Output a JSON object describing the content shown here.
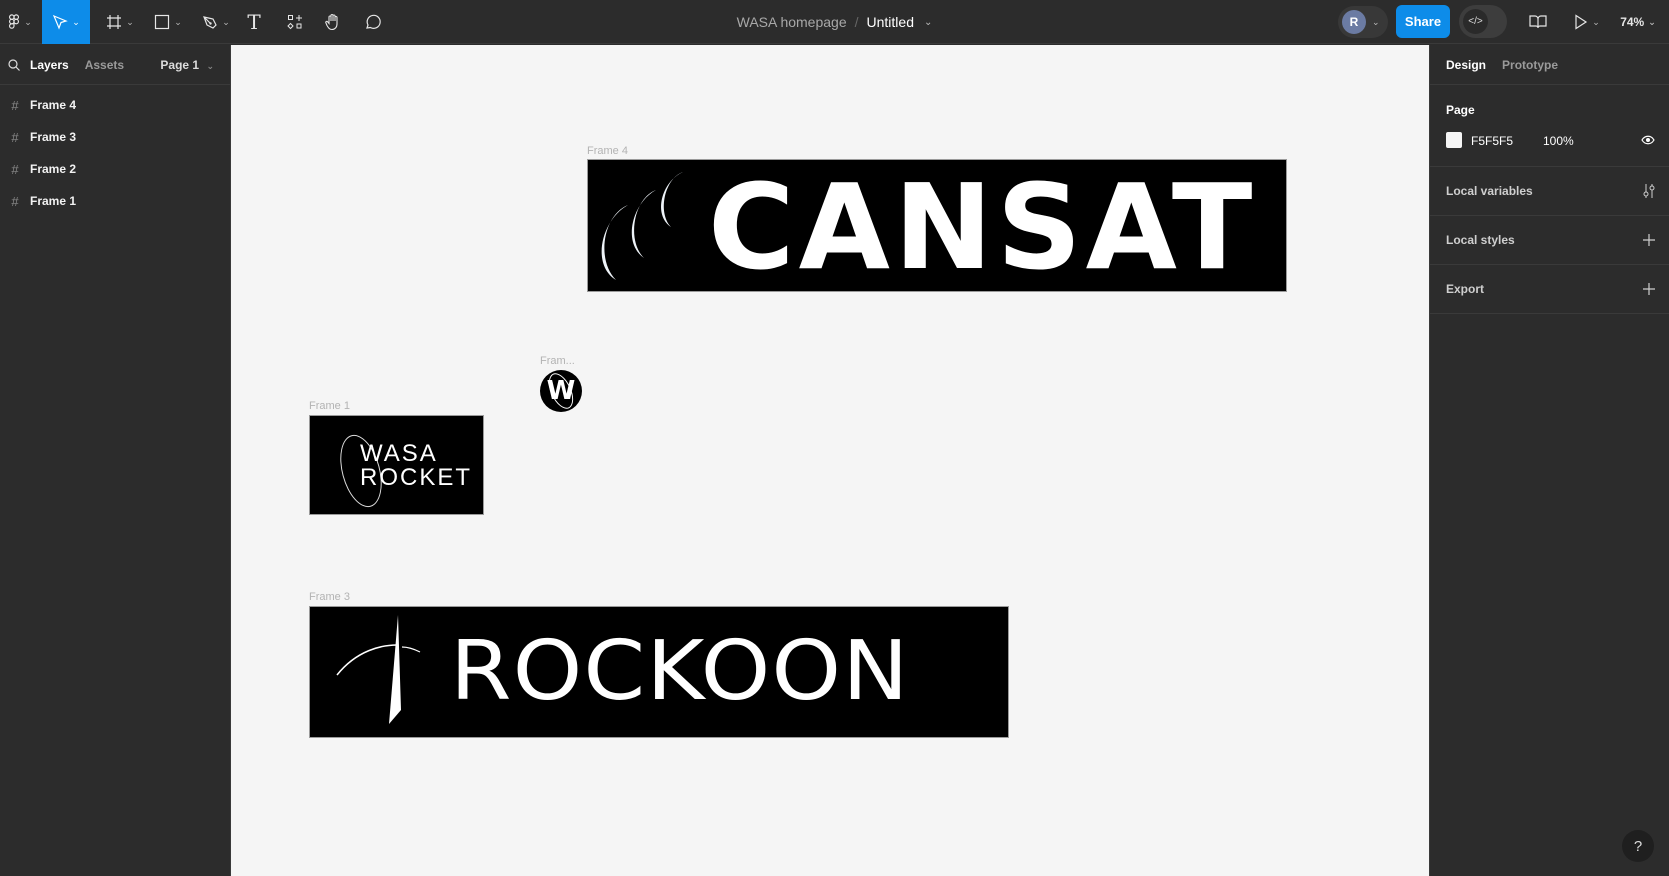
{
  "toolbar": {
    "tools": [
      {
        "name": "main-menu",
        "icon": "figma-logo-icon"
      },
      {
        "name": "move-tool",
        "icon": "pointer-icon",
        "active": true
      },
      {
        "name": "frame-tool",
        "icon": "frame-hash-icon"
      },
      {
        "name": "shape-tool",
        "icon": "rectangle-icon"
      },
      {
        "name": "pen-tool",
        "icon": "pen-icon"
      },
      {
        "name": "text-tool",
        "icon": "text-icon",
        "glyph": "T"
      },
      {
        "name": "resources-tool",
        "icon": "resources-icon"
      },
      {
        "name": "hand-tool",
        "icon": "hand-icon"
      },
      {
        "name": "comment-tool",
        "icon": "comment-icon"
      }
    ],
    "breadcrumb": {
      "project": "WASA homepage",
      "separator": "/",
      "file": "Untitled"
    },
    "avatar_initial": "R",
    "share_label": "Share",
    "dev_mode_glyph": "</>",
    "zoom_level": "74%"
  },
  "left_panel": {
    "tabs": [
      {
        "label": "Layers",
        "active": true
      },
      {
        "label": "Assets",
        "active": false
      }
    ],
    "page_selector": "Page 1",
    "layers": [
      {
        "label": "Frame 4"
      },
      {
        "label": "Frame 3"
      },
      {
        "label": "Frame 2"
      },
      {
        "label": "Frame 1"
      }
    ]
  },
  "canvas": {
    "background": "#F5F5F5",
    "frames": {
      "frame4": {
        "label": "Frame 4",
        "logo_text": "CANSAT"
      },
      "frame2": {
        "label": "Fram...",
        "logo_glyph": "W"
      },
      "frame1": {
        "label": "Frame 1",
        "logo_line1": "WASA",
        "logo_line2": "ROCKET"
      },
      "frame3": {
        "label": "Frame 3",
        "logo_text": "ROCKOON"
      }
    }
  },
  "right_panel": {
    "tabs": [
      {
        "label": "Design",
        "active": true
      },
      {
        "label": "Prototype",
        "active": false
      }
    ],
    "page": {
      "title": "Page",
      "color_hex": "F5F5F5",
      "opacity": "100%"
    },
    "sections": [
      {
        "label": "Local variables",
        "icon": "sliders-icon"
      },
      {
        "label": "Local styles",
        "icon": "plus-icon"
      },
      {
        "label": "Export",
        "icon": "plus-icon"
      }
    ]
  },
  "help_glyph": "?"
}
